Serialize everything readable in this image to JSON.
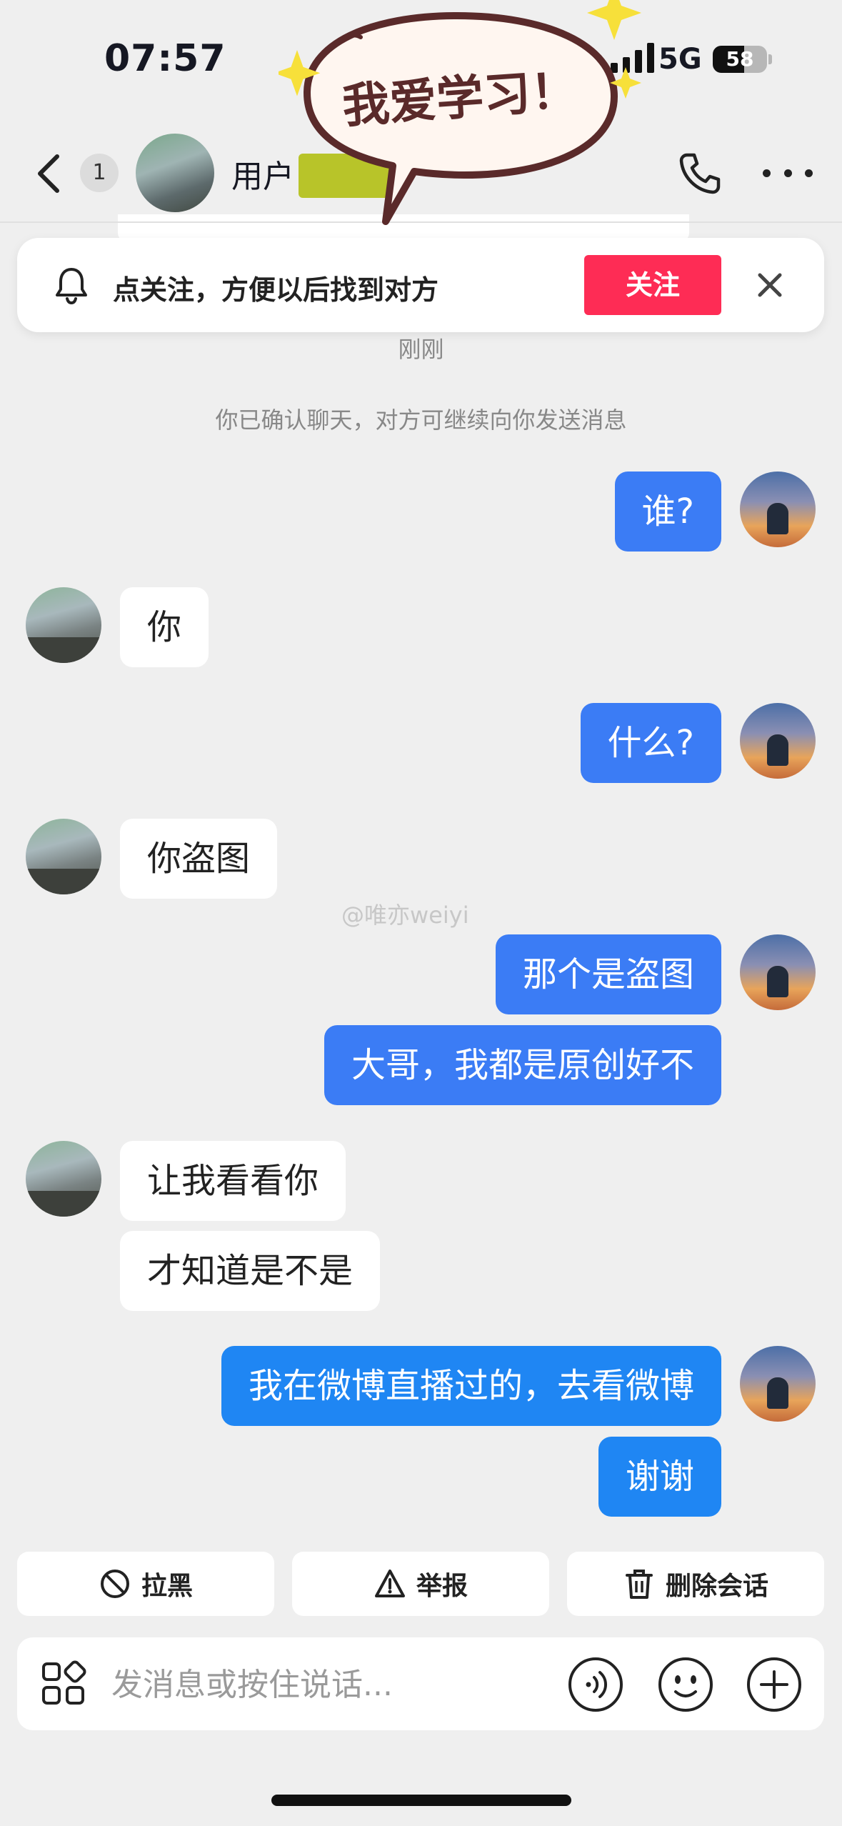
{
  "status_bar": {
    "time": "07:57",
    "network": "5G",
    "battery": "58",
    "battery_level": 0.58
  },
  "header": {
    "unread_count": "1",
    "peer_name": "用户"
  },
  "sticker": {
    "text": "我爱学习！"
  },
  "follow_banner": {
    "text": "点关注，方便以后找到对方",
    "follow_label": "关注"
  },
  "chat": {
    "timestamp": "刚刚",
    "system_message": "你已确认聊天，对方可继续向你发送消息",
    "watermark": "@唯亦weiyi",
    "messages": [
      {
        "sender": "self",
        "text": "谁?"
      },
      {
        "sender": "peer",
        "text": "你"
      },
      {
        "sender": "self",
        "text": "什么?"
      },
      {
        "sender": "peer",
        "text": "你盗图"
      },
      {
        "sender": "self",
        "text": "那个是盗图"
      },
      {
        "sender": "self",
        "text": "大哥，我都是原创好不"
      },
      {
        "sender": "peer",
        "text": "让我看看你"
      },
      {
        "sender": "peer",
        "text": "才知道是不是"
      },
      {
        "sender": "self",
        "text": "我在微博直播过的，去看微博"
      },
      {
        "sender": "self",
        "text": "谢谢"
      }
    ]
  },
  "actions": {
    "block": "拉黑",
    "report": "举报",
    "delete": "删除会话"
  },
  "input": {
    "placeholder": "发消息或按住说话..."
  },
  "colors": {
    "self_bubble": "#3b7cf5",
    "self_bubble_alt": "#1f86f3",
    "follow": "#fe2c55",
    "sticker_fill": "#fff6f0",
    "sticker_outline": "#5a2a2a",
    "sparkle": "#f7e03a"
  }
}
